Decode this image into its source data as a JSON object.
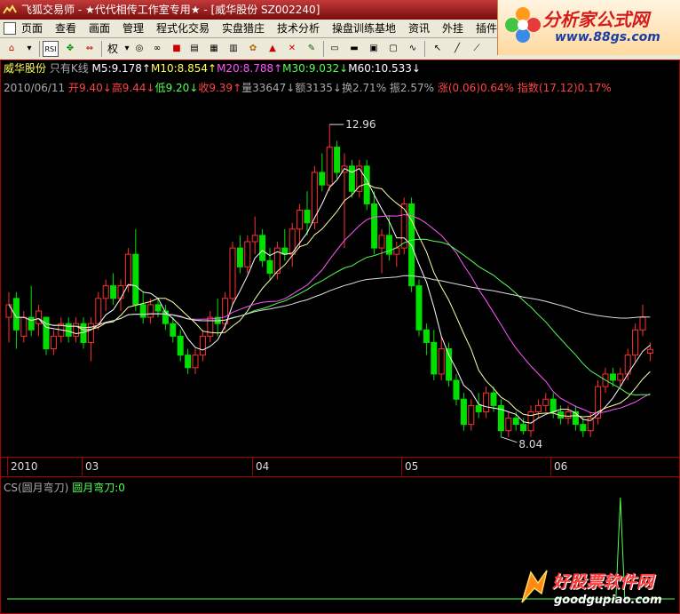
{
  "window": {
    "app_name": "飞狐交易师",
    "separator1": "-",
    "studio": "★代代相传工作室专用★",
    "separator2": "-",
    "stock_tag": "[威华股份 SZ002240]"
  },
  "menu": [
    "页面",
    "查看",
    "画面",
    "管理",
    "程式化交易",
    "实盘猎庄",
    "技术分析",
    "操盘训练基地",
    "资讯",
    "外挂",
    "插件",
    "帮助"
  ],
  "toolbar": {
    "rsi_label": "RSI",
    "quan_label": "权"
  },
  "logo": {
    "main": "分析家公式网",
    "url": "www.88gs.com"
  },
  "info_line1": {
    "stock": "威华股份",
    "mode": "只有K线",
    "ma5": "M5:9.178↑",
    "ma10": "M10:8.854↑",
    "ma20": "M20:8.788↑",
    "ma30": "M30:9.032↓",
    "ma60": "M60:10.533↓"
  },
  "info_line2": {
    "date": "2010/06/11",
    "open": "开9.40↓",
    "high": "高9.44↓",
    "low": "低9.20↓",
    "close": "收9.39↑",
    "volume": "量33647↓",
    "amount": "额3135↓",
    "turnover": "换2.71%",
    "amplitude": "振2.57%",
    "change": "涨(0.06)0.64%",
    "index": "指数(17.12)0.17%"
  },
  "chart_labels": {
    "high_mark": "12.96",
    "low_mark": "8.04"
  },
  "time_axis": [
    "2010",
    "03",
    "04",
    "05",
    "06"
  ],
  "indicator": {
    "name": "CS(圆月弯刀)",
    "value": "圆月弯刀:0"
  },
  "watermark": {
    "main": "好股票软件网",
    "url": "goodgupiao.com"
  },
  "colors": {
    "up": "#ff3030",
    "down": "#00e000",
    "ma5": "#ffffff",
    "ma10": "#ffffaa",
    "ma20": "#ff55ff",
    "ma30": "#55ff55",
    "ma60": "#dddddd"
  },
  "chart_data": {
    "type": "candlestick",
    "price_range": [
      7.8,
      13.3
    ],
    "candles": [
      [
        9.9,
        10.3,
        9.5,
        10.1
      ],
      [
        10.2,
        10.3,
        9.4,
        9.7
      ],
      [
        9.6,
        10.0,
        9.5,
        9.9
      ],
      [
        9.9,
        10.4,
        9.6,
        9.7
      ],
      [
        9.8,
        10.1,
        9.6,
        10.0
      ],
      [
        9.9,
        9.9,
        9.3,
        9.4
      ],
      [
        9.4,
        9.7,
        9.3,
        9.6
      ],
      [
        9.6,
        9.9,
        9.5,
        9.8
      ],
      [
        9.8,
        9.9,
        9.5,
        9.6
      ],
      [
        9.6,
        9.9,
        9.5,
        9.8
      ],
      [
        9.8,
        9.9,
        9.4,
        9.5
      ],
      [
        9.5,
        9.9,
        9.2,
        9.8
      ],
      [
        9.8,
        10.3,
        9.7,
        10.2
      ],
      [
        10.2,
        10.5,
        10.0,
        10.4
      ],
      [
        10.4,
        10.6,
        10.1,
        10.2
      ],
      [
        10.2,
        10.5,
        10.0,
        10.4
      ],
      [
        10.4,
        11.0,
        10.3,
        10.9
      ],
      [
        10.9,
        11.3,
        10.0,
        10.1
      ],
      [
        10.1,
        10.3,
        9.8,
        9.9
      ],
      [
        9.9,
        10.2,
        9.8,
        10.1
      ],
      [
        10.1,
        10.2,
        9.9,
        10.0
      ],
      [
        10.0,
        10.1,
        9.7,
        9.8
      ],
      [
        9.8,
        9.9,
        9.5,
        9.6
      ],
      [
        9.6,
        9.7,
        9.2,
        9.3
      ],
      [
        9.3,
        9.4,
        9.0,
        9.1
      ],
      [
        9.1,
        9.4,
        9.0,
        9.3
      ],
      [
        9.3,
        9.7,
        9.2,
        9.6
      ],
      [
        9.6,
        10.0,
        9.5,
        9.9
      ],
      [
        9.9,
        10.2,
        9.6,
        9.8
      ],
      [
        9.8,
        10.3,
        9.7,
        10.2
      ],
      [
        10.2,
        11.1,
        10.1,
        11.0
      ],
      [
        11.0,
        11.2,
        10.6,
        10.7
      ],
      [
        10.7,
        11.2,
        10.6,
        11.1
      ],
      [
        11.1,
        11.5,
        10.9,
        11.2
      ],
      [
        11.2,
        11.3,
        10.7,
        10.8
      ],
      [
        10.8,
        11.0,
        10.5,
        10.6
      ],
      [
        10.6,
        11.1,
        10.5,
        11.0
      ],
      [
        11.0,
        11.3,
        10.8,
        10.9
      ],
      [
        10.9,
        11.4,
        10.7,
        11.3
      ],
      [
        11.3,
        11.7,
        11.0,
        11.6
      ],
      [
        11.6,
        11.9,
        11.2,
        11.4
      ],
      [
        11.4,
        12.3,
        11.3,
        12.2
      ],
      [
        12.2,
        12.5,
        11.9,
        12.0
      ],
      [
        12.0,
        12.96,
        11.9,
        12.6
      ],
      [
        12.6,
        12.7,
        12.1,
        12.2
      ],
      [
        12.2,
        12.5,
        11.0,
        12.3
      ],
      [
        12.3,
        12.4,
        11.8,
        11.9
      ],
      [
        11.9,
        12.4,
        11.8,
        12.3
      ],
      [
        12.3,
        12.4,
        11.6,
        11.7
      ],
      [
        11.7,
        11.9,
        10.9,
        11.0
      ],
      [
        11.0,
        11.3,
        10.6,
        11.2
      ],
      [
        11.2,
        11.5,
        10.8,
        10.9
      ],
      [
        10.9,
        11.1,
        10.7,
        11.0
      ],
      [
        11.0,
        11.8,
        10.9,
        11.7
      ],
      [
        11.7,
        11.8,
        10.3,
        10.4
      ],
      [
        10.4,
        10.5,
        9.6,
        9.7
      ],
      [
        9.7,
        9.8,
        9.3,
        9.5
      ],
      [
        9.5,
        9.7,
        8.9,
        9.0
      ],
      [
        9.0,
        9.6,
        8.9,
        9.4
      ],
      [
        9.4,
        9.5,
        8.8,
        8.9
      ],
      [
        8.9,
        9.0,
        8.5,
        8.6
      ],
      [
        8.6,
        8.7,
        8.1,
        8.2
      ],
      [
        8.2,
        8.6,
        8.1,
        8.5
      ],
      [
        8.5,
        8.7,
        8.3,
        8.4
      ],
      [
        8.4,
        8.8,
        8.3,
        8.7
      ],
      [
        8.7,
        8.8,
        8.4,
        8.5
      ],
      [
        8.5,
        8.6,
        8.0,
        8.1
      ],
      [
        8.1,
        8.4,
        8.0,
        8.3
      ],
      [
        8.3,
        8.4,
        8.1,
        8.2
      ],
      [
        8.2,
        8.3,
        8.04,
        8.1
      ],
      [
        8.1,
        8.5,
        8.0,
        8.4
      ],
      [
        8.4,
        8.6,
        8.3,
        8.5
      ],
      [
        8.5,
        8.7,
        8.4,
        8.6
      ],
      [
        8.6,
        8.7,
        8.3,
        8.4
      ],
      [
        8.4,
        8.5,
        8.2,
        8.3
      ],
      [
        8.3,
        8.5,
        8.2,
        8.4
      ],
      [
        8.4,
        8.5,
        8.1,
        8.2
      ],
      [
        8.2,
        8.3,
        8.0,
        8.1
      ],
      [
        8.1,
        8.4,
        8.0,
        8.3
      ],
      [
        8.3,
        8.9,
        8.2,
        8.8
      ],
      [
        8.8,
        9.1,
        8.7,
        9.0
      ],
      [
        9.0,
        9.1,
        8.8,
        8.9
      ],
      [
        8.9,
        9.1,
        8.8,
        9.0
      ],
      [
        9.0,
        9.4,
        8.9,
        9.3
      ],
      [
        9.3,
        9.8,
        9.2,
        9.7
      ],
      [
        9.7,
        10.1,
        9.6,
        9.9
      ],
      [
        9.33,
        9.5,
        9.2,
        9.39
      ]
    ],
    "indicator_spike_index": 82
  }
}
